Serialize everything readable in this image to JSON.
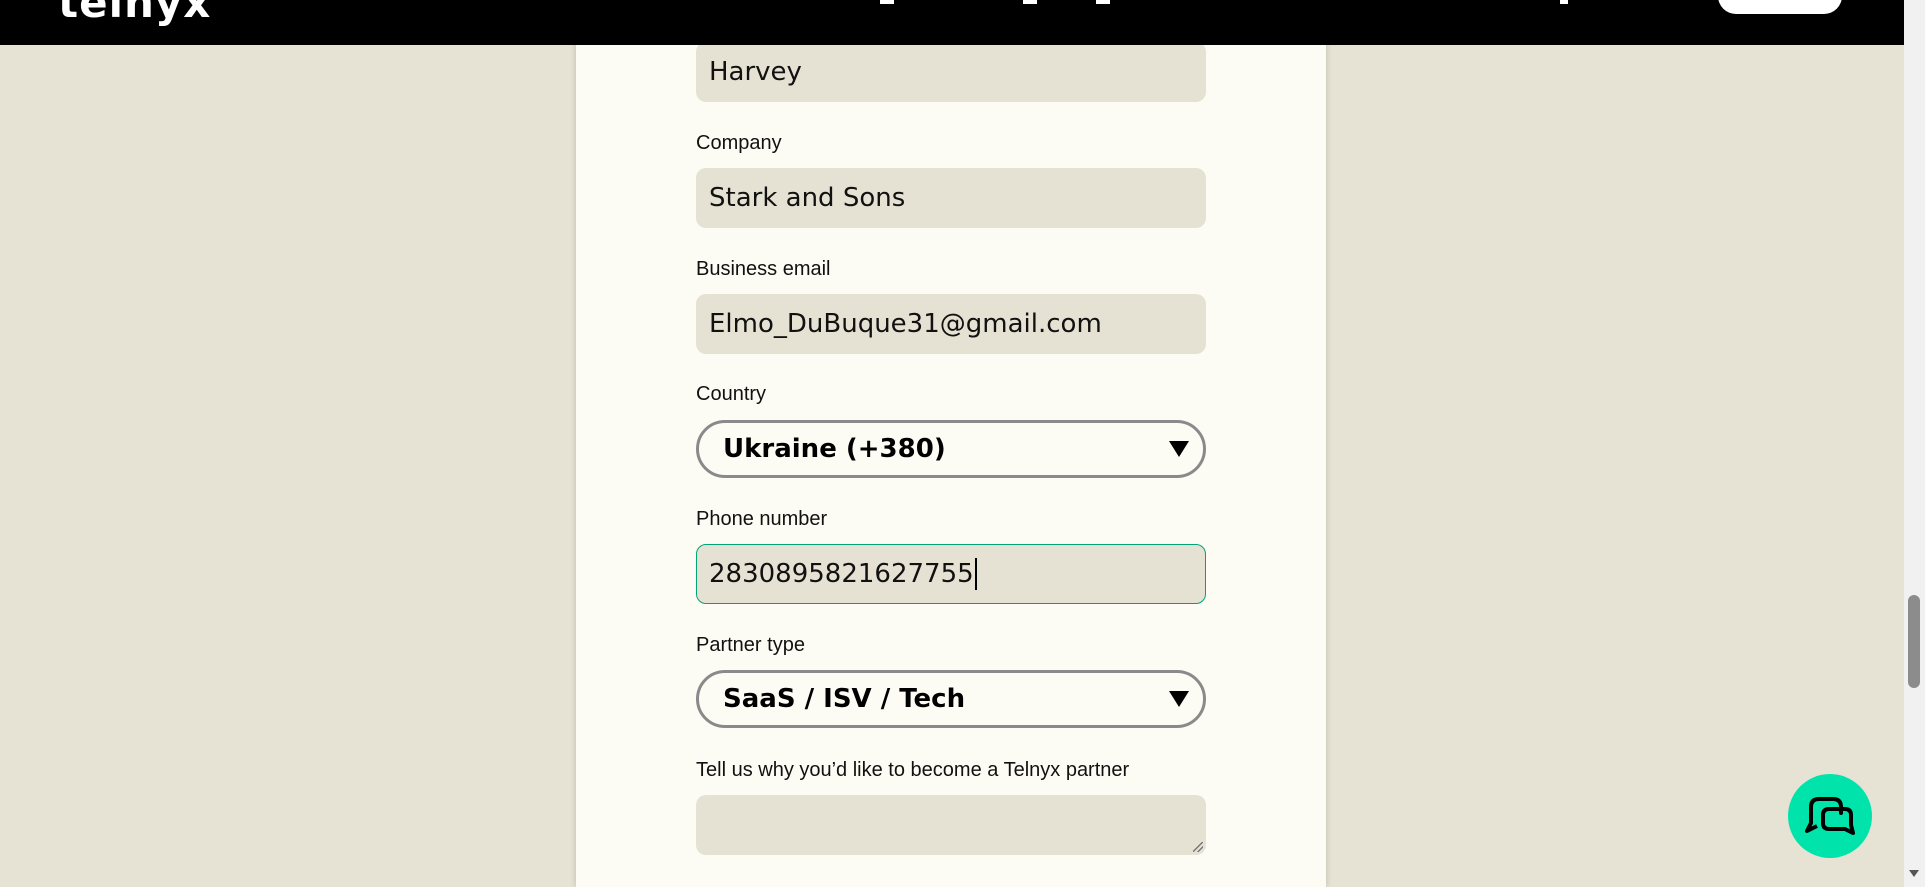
{
  "header": {
    "logo_text": "telnyx"
  },
  "form": {
    "last_name_value": "Harvey",
    "company_label": "Company",
    "company_value": "Stark and Sons",
    "email_label": "Business email",
    "email_value": "Elmo_DuBuque31@gmail.com",
    "country_label": "Country",
    "country_value": "Ukraine (+380)",
    "phone_label": "Phone number",
    "phone_value": "2830895821627755",
    "partner_label": "Partner type",
    "partner_value": "SaaS / ISV / Tech",
    "reason_label": "Tell us why you’d like to become a Telnyx partner",
    "reason_value": ""
  },
  "colors": {
    "page_bg": "#e6e3d4",
    "panel_bg": "#fdfcf4",
    "input_bg": "#e6e2d3",
    "accent": "#00e3aa",
    "focus_border": "#00a37a"
  },
  "icons": {
    "chat": "chat-bubbles-icon",
    "select_arrow": "triangle-down-icon"
  }
}
